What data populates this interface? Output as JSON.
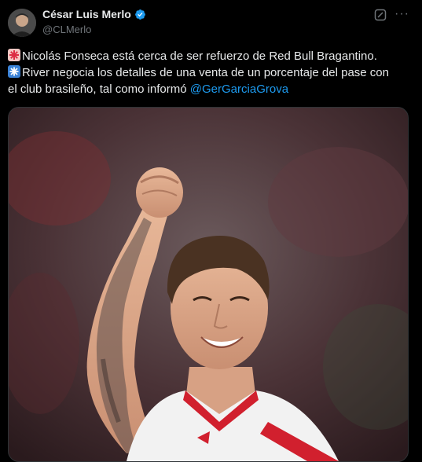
{
  "author": {
    "display_name": "César Luis Merlo",
    "handle": "@CLMerlo",
    "verified": true
  },
  "tweet": {
    "line1": "Nicolás Fonseca está cerca de ser refuerzo de Red Bull Bragantino.",
    "line2": "River negocia los detalles de una venta de un porcentaje del pase con",
    "line3_text": "el club brasileño, tal como informó ",
    "mention": "@GerGarciaGrova"
  },
  "icons": {
    "more": "more-options-icon",
    "grok": "grok-icon",
    "verified": "verified-badge-icon",
    "emoji1": "red-asterisk-emoji-icon",
    "emoji2": "blue-asterisk-emoji-icon"
  },
  "colors": {
    "background": "#000000",
    "text": "#e7e9ea",
    "secondary": "#71767b",
    "link": "#1d9bf0",
    "verified": "#1d9bf0"
  }
}
